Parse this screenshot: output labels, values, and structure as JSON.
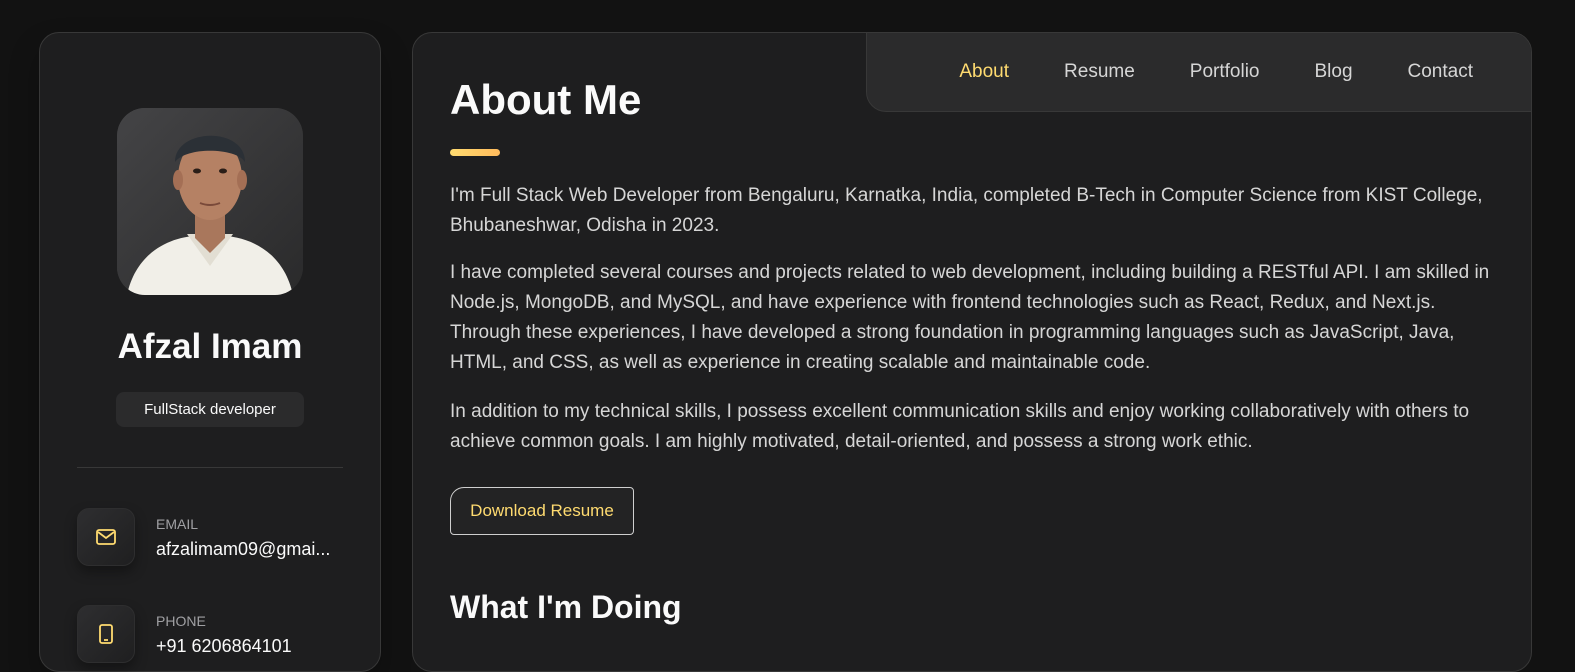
{
  "profile": {
    "name": "Afzal Imam",
    "title": "FullStack developer"
  },
  "contacts": [
    {
      "label": "EMAIL",
      "value": "afzalimam09@gmai...",
      "icon": "mail-icon"
    },
    {
      "label": "PHONE",
      "value": "+91 6206864101",
      "icon": "phone-icon"
    }
  ],
  "nav": {
    "items": [
      "About",
      "Resume",
      "Portfolio",
      "Blog",
      "Contact"
    ],
    "active": "About"
  },
  "about": {
    "heading": "About Me",
    "paragraphs": [
      "I'm Full Stack Web Developer from Bengaluru, Karnatka, India, completed B-Tech in Computer Science from KIST College, Bhubaneshwar, Odisha in 2023.",
      "I have completed several courses and projects related to web development, including building a RESTful API. I am skilled in Node.js, MongoDB, and MySQL, and have experience with frontend technologies such as React, Redux, and Next.js. Through these experiences, I have developed a strong foundation in programming languages such as JavaScript, Java, HTML, and CSS, as well as experience in creating scalable and maintainable code.",
      "In addition to my technical skills, I possess excellent communication skills and enjoy working collaboratively with others to achieve common goals. I am highly motivated, detail-oriented, and possess a strong work ethic."
    ],
    "download_label": "Download Resume",
    "doing_heading": "What I'm Doing"
  },
  "colors": {
    "accent": "#ffdb70",
    "background": "#121212",
    "card": "#1e1e1f"
  }
}
